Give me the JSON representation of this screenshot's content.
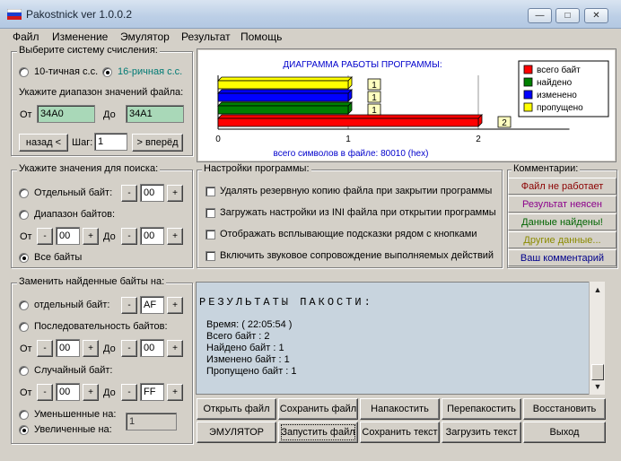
{
  "window": {
    "title": "Pakostnick ver 1.0.0.2"
  },
  "menu": [
    "Файл",
    "Изменение",
    "Эмулятор",
    "Результат",
    "Помощь"
  ],
  "number_system": {
    "title": "Выберите систему счисления:",
    "options": [
      "10-тичная с.с.",
      "16-ричная с.с."
    ],
    "selected": 1
  },
  "range": {
    "title": "Укажите диапазон значений файла:",
    "from_label": "От",
    "from_value": "34A0",
    "to_label": "До",
    "to_value": "34A1",
    "back_label": "назад <",
    "step_label": "Шаг:",
    "step_value": "1",
    "forward_label": "> вперёд"
  },
  "chart_data": {
    "type": "bar",
    "orientation": "horizontal",
    "title": "ДИАГРАММА РАБОТЫ ПРОГРАММЫ:",
    "xlabel": "всего символов в файле: 80010 (hex)",
    "xlim": [
      0,
      2.7
    ],
    "xticks": [
      "0",
      "1",
      "2"
    ],
    "legend_position": "right",
    "series": [
      {
        "name": "всего байт",
        "value": 2,
        "label": "2",
        "color": "#ff0000"
      },
      {
        "name": "найдено",
        "value": 1,
        "label": "1",
        "color": "#008000"
      },
      {
        "name": "изменено",
        "value": 1,
        "label": "1",
        "color": "#0000ff"
      },
      {
        "name": "пропущено",
        "value": 1,
        "label": "1",
        "color": "#ffff00"
      }
    ]
  },
  "search": {
    "title": "Укажите значения для поиска:",
    "single_byte_label": "Отдельный байт:",
    "single_byte_value": "00",
    "range_label": "Диапазон байтов:",
    "from_label": "От",
    "from_value": "00",
    "to_label": "До",
    "to_value": "00",
    "all_bytes_label": "Все байты",
    "minus": "-",
    "plus": "+"
  },
  "settings": {
    "title": "Настройки программы:",
    "options": [
      "Удалять резервную копию файла при закрытии программы",
      "Загружать настройки из INI файла при открытии программы",
      "Отображать всплывающие подсказки рядом с кнопками",
      "Включить звуковое сопровождение выполняемых действий"
    ]
  },
  "comments": {
    "title": "Комментарии:",
    "items": [
      {
        "label": "Файл не работает",
        "color": "#8b0000"
      },
      {
        "label": "Результат неясен",
        "color": "#8b008b"
      },
      {
        "label": "Данные найдены!",
        "color": "#006400"
      },
      {
        "label": "Другие данные...",
        "color": "#8b8b00"
      },
      {
        "label": "Ваш комментарий",
        "color": "#00008b"
      }
    ]
  },
  "replace": {
    "title": "Заменить найденные байты на:",
    "single_byte_label": "отдельный байт:",
    "single_byte_value": "AF",
    "sequence_label": "Последовательность байтов:",
    "seq_from_label": "От",
    "seq_from_value": "00",
    "seq_to_label": "До",
    "seq_to_value": "00",
    "random_label": "Случайный байт:",
    "rnd_from_label": "От",
    "rnd_from_value": "00",
    "rnd_to_label": "До",
    "rnd_to_value": "FF",
    "decreased_label": "Уменьшенные на:",
    "increased_label": "Увеличенные на:",
    "delta_value": "1",
    "minus": "-",
    "plus": "+"
  },
  "results": {
    "heading": "РЕЗУЛЬТАТЫ ПАКОСТИ:",
    "lines": [
      "Время: ( 22:05:54 )",
      "Всего байт : 2",
      "Найдено байт : 1",
      "Изменено байт : 1",
      "Пропущено байт : 1"
    ]
  },
  "buttons": {
    "row1": [
      "Открыть файл",
      "Сохранить файл",
      "Напакостить",
      "Перепакостить",
      "Восстановить"
    ],
    "row2": [
      "ЭМУЛЯТОР",
      "Запустить файл",
      "Сохранить текст",
      "Загрузить текст",
      "Выход"
    ]
  }
}
